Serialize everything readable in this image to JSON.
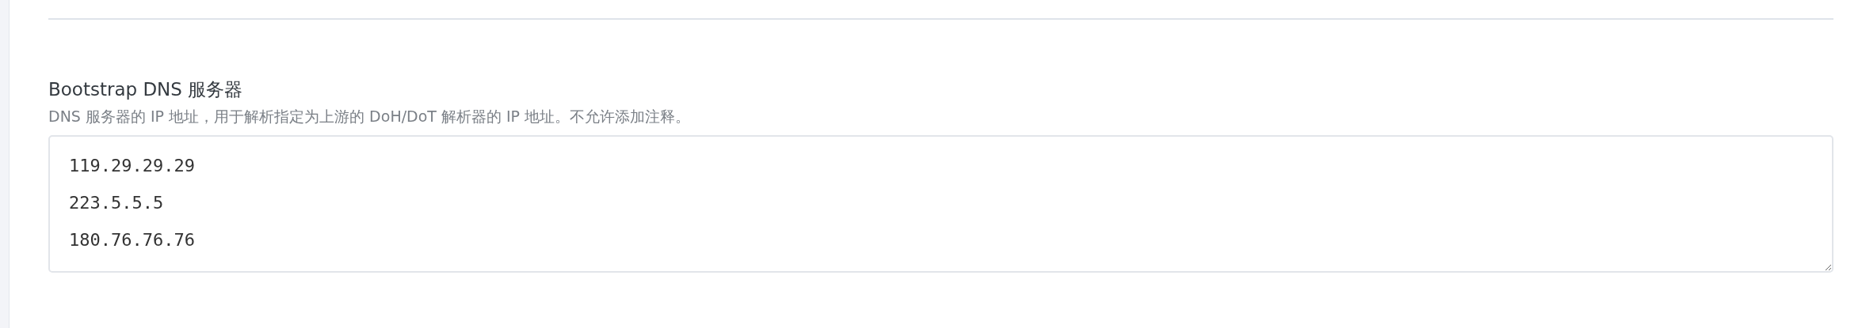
{
  "field": {
    "label": "Bootstrap DNS 服务器",
    "hint": "DNS 服务器的 IP 地址，用于解析指定为上游的 DoH/DoT 解析器的 IP 地址。不允许添加注释。",
    "value": [
      "119.29.29.29",
      "223.5.5.5",
      "180.76.76.76"
    ]
  }
}
